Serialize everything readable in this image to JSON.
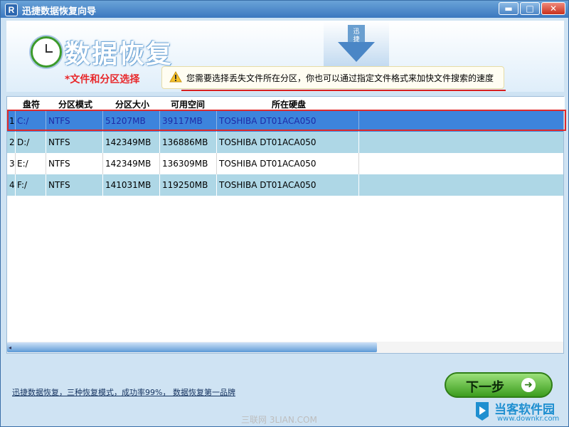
{
  "window": {
    "title": "迅捷数据恢复向导",
    "app_icon_letter": "R",
    "min_glyph": "▬",
    "max_glyph": "□",
    "close_glyph": "✕"
  },
  "header": {
    "title": "数据恢复",
    "subtitle": "*文件和分区选择",
    "tip": "您需要选择丢失文件所在分区，你也可以通过指定文件格式来加快文件搜索的速度",
    "arrow_glyph_text": "迅捷"
  },
  "table": {
    "columns": [
      "盘符",
      "分区模式",
      "分区大小",
      "可用空间",
      "所在硬盘"
    ],
    "rows": [
      {
        "index": "1",
        "drive": "C:/",
        "mode": "NTFS",
        "size": "51207MB",
        "free": "39117MB",
        "disk": "TOSHIBA DT01ACA050",
        "selected": true
      },
      {
        "index": "2",
        "drive": "D:/",
        "mode": "NTFS",
        "size": "142349MB",
        "free": "136886MB",
        "disk": "TOSHIBA DT01ACA050",
        "selected": false
      },
      {
        "index": "3",
        "drive": "E:/",
        "mode": "NTFS",
        "size": "142349MB",
        "free": "136309MB",
        "disk": "TOSHIBA DT01ACA050",
        "selected": false
      },
      {
        "index": "4",
        "drive": "F:/",
        "mode": "NTFS",
        "size": "141031MB",
        "free": "119250MB",
        "disk": "TOSHIBA DT01ACA050",
        "selected": false
      }
    ],
    "scroll_left_glyph": "◂"
  },
  "footer": {
    "link_text": "迅捷数据恢复，三种恢复模式，成功率99%， 数据恢复第一品牌",
    "next_label": "下一步",
    "next_arrow_glyph": "➜"
  },
  "watermarks": {
    "center": "三联网 3LIAN.COM",
    "logo_name": "当客软件园",
    "logo_url": "www.downkr.com"
  },
  "colors": {
    "accent_blue": "#3d84dc",
    "selection_outline": "#e02a2a",
    "subtitle_red": "#e8282b",
    "next_button_green": "#3b9d1e"
  }
}
